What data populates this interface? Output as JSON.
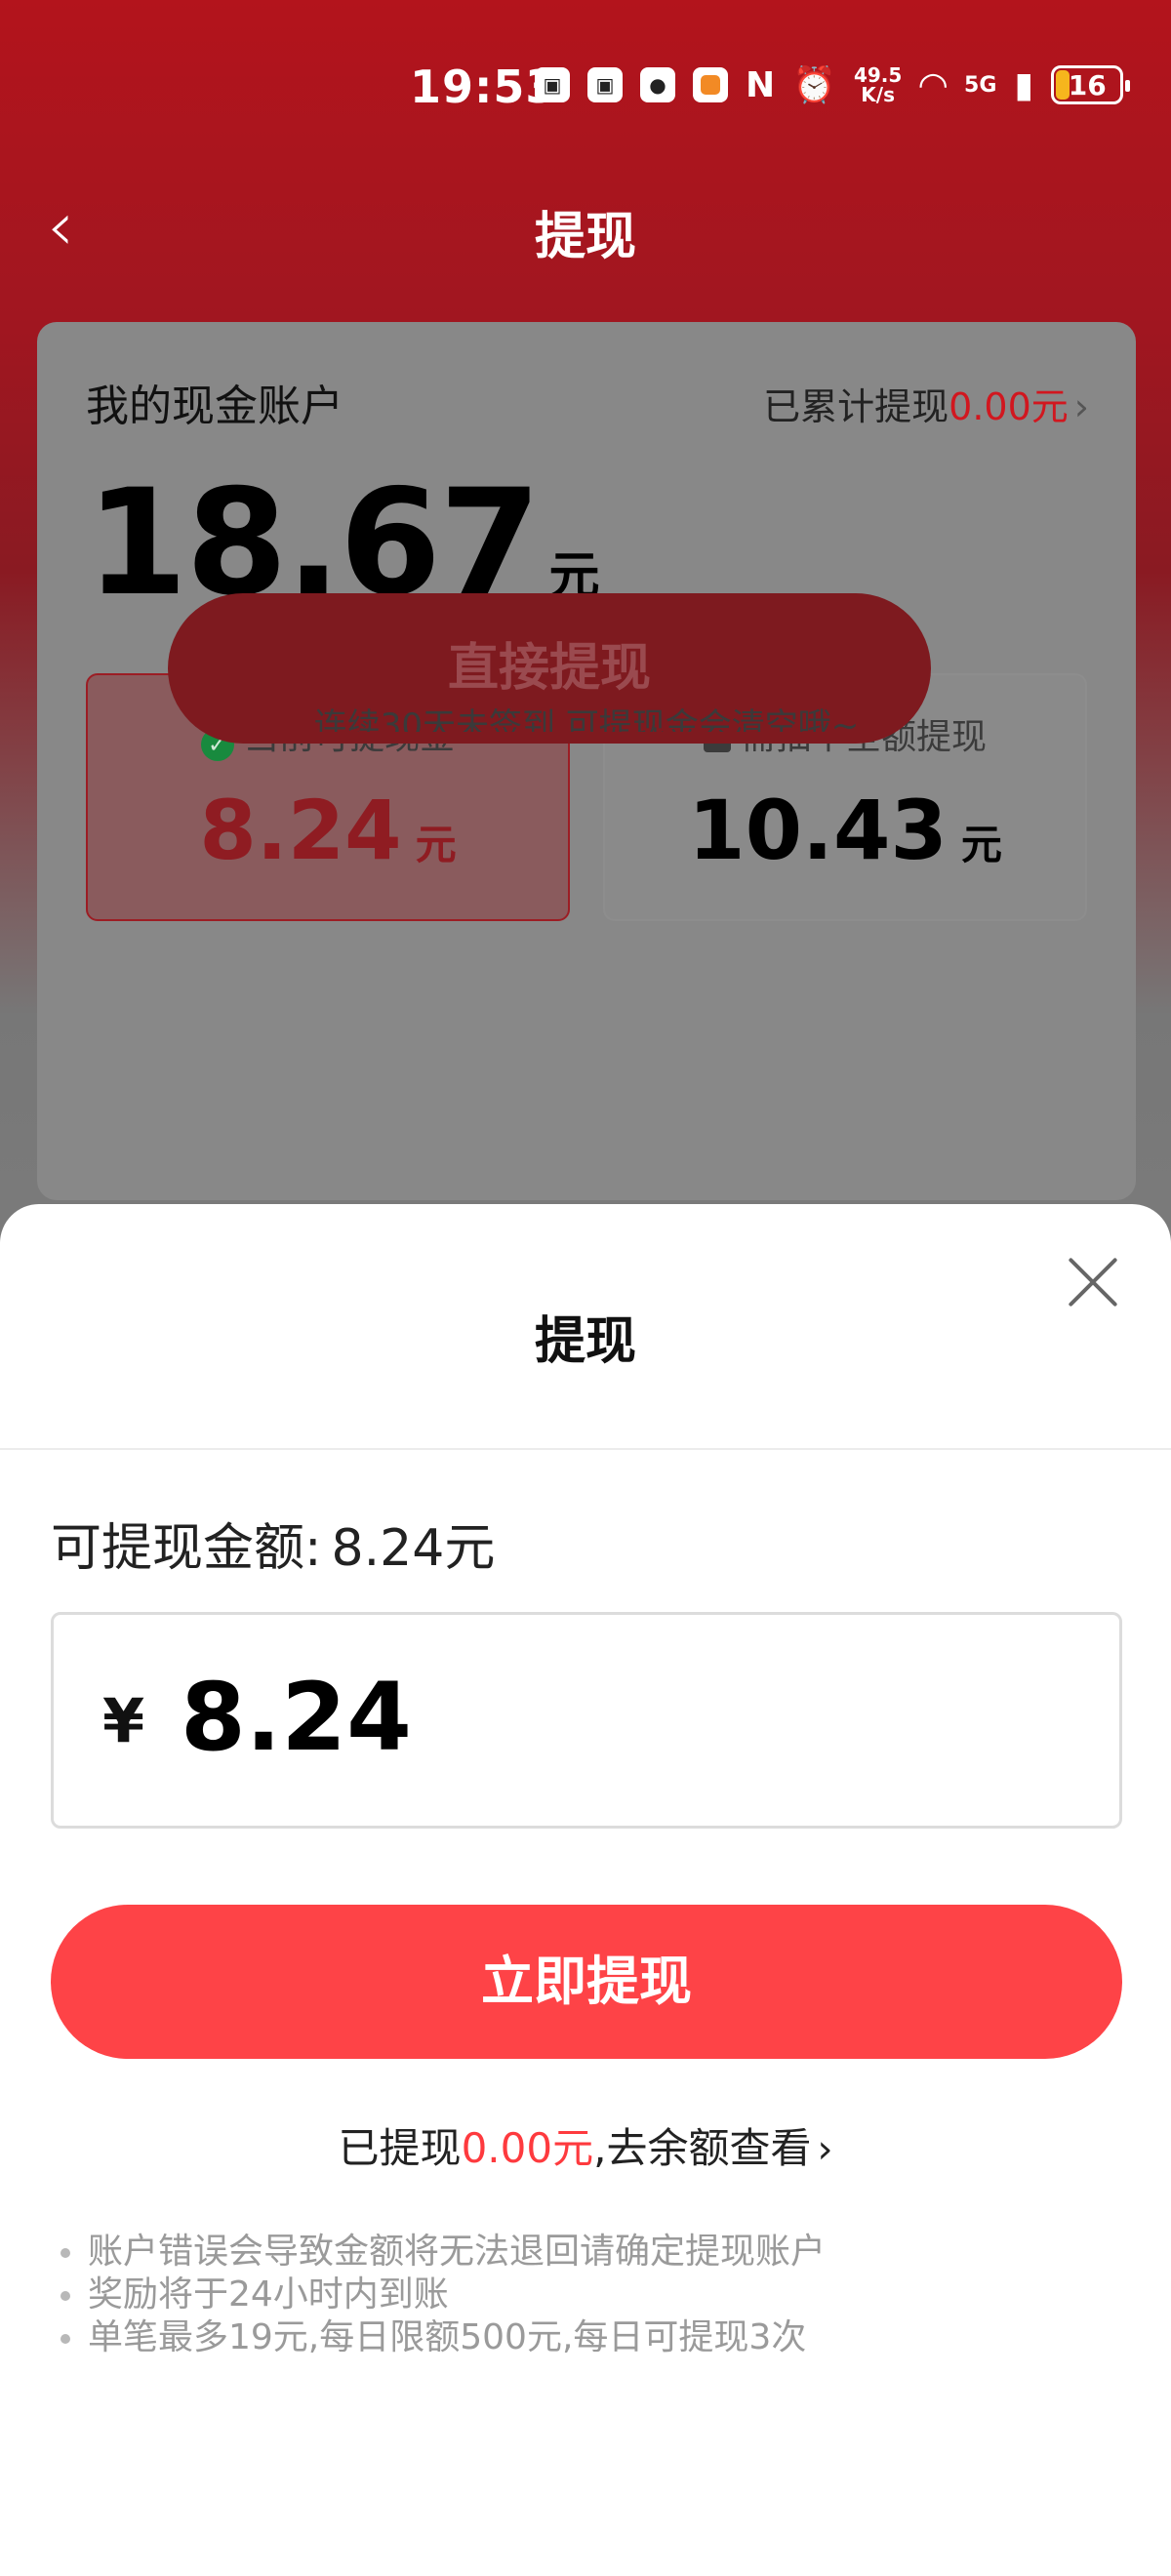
{
  "status_bar": {
    "time": "19:53",
    "net_speed_top": "49.5",
    "net_speed_bottom": "K/s",
    "network": "5G",
    "battery": "16"
  },
  "nav": {
    "back_icon": "chevron-left-icon",
    "title": "提现"
  },
  "account_card": {
    "title": "我的现金账户",
    "total_prefix": "已累计提现",
    "total_amount": "0.00元",
    "balance": "18.67",
    "balance_unit": "元",
    "available_tile": {
      "label": "当前可提现金",
      "value": "8.24",
      "unit": "元"
    },
    "locked_tile": {
      "label": "需抽中全额提现",
      "value": "10.43",
      "unit": "元"
    },
    "direct_button": "直接提现",
    "hint": "连续30天未签到,可提现金会清空哦~"
  },
  "sheet": {
    "title": "提现",
    "available_label": "可提现金额:",
    "available_amount": "8.24元",
    "currency_symbol": "¥",
    "amount_value": "8.24",
    "submit_button": "立即提现",
    "withdrawn_prefix": "已提现",
    "withdrawn_amount": "0.00元",
    "withdrawn_suffix": ",去余额查看",
    "rules": [
      "账户错误会导致金额将无法退回请确定提现账户",
      "奖励将于24小时内到账",
      "单笔最多19元,每日限额500元,每日可提现3次"
    ]
  },
  "colors": {
    "brand_red": "#fe4347",
    "header_red": "#b3141c",
    "highlight_red": "#d1171f"
  }
}
